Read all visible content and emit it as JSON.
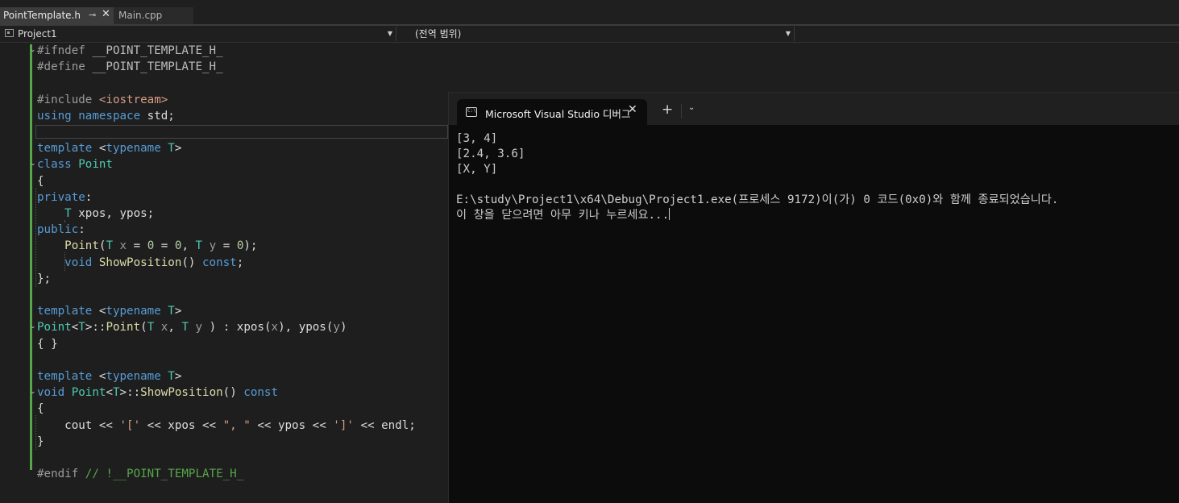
{
  "tabs": [
    {
      "label": "PointTemplate.h",
      "active": true
    },
    {
      "label": "Main.cpp",
      "active": false
    }
  ],
  "nav": {
    "project": "Project1",
    "scope": "(전역 범위)"
  },
  "editor": {
    "lines": [
      {
        "t": [
          [
            "pp",
            "#ifndef "
          ],
          [
            "macro",
            "__POINT_TEMPLATE_H_"
          ]
        ]
      },
      {
        "t": [
          [
            "pp",
            "#define "
          ],
          [
            "macro",
            "__POINT_TEMPLATE_H_"
          ]
        ]
      },
      {
        "t": []
      },
      {
        "t": [
          [
            "pp",
            "#include "
          ],
          [
            "inc",
            "<iostream>"
          ]
        ]
      },
      {
        "t": [
          [
            "kw",
            "using namespace "
          ],
          [
            "",
            "std;"
          ]
        ]
      },
      {
        "t": []
      },
      {
        "t": [
          [
            "kw",
            "template "
          ],
          [
            "",
            "<"
          ],
          [
            "kw",
            "typename "
          ],
          [
            "ty",
            "T"
          ],
          [
            "",
            ">"
          ]
        ]
      },
      {
        "t": [
          [
            "kw",
            "class "
          ],
          [
            "ty",
            "Point"
          ]
        ]
      },
      {
        "t": [
          [
            "",
            "{"
          ]
        ]
      },
      {
        "t": [
          [
            "kw",
            "private"
          ],
          [
            "",
            ":"
          ]
        ]
      },
      {
        "t": [
          [
            "",
            "    "
          ],
          [
            "ty",
            "T "
          ],
          [
            "mem",
            "xpos, ypos;"
          ]
        ]
      },
      {
        "t": [
          [
            "kw",
            "public"
          ],
          [
            "",
            ":"
          ]
        ]
      },
      {
        "t": [
          [
            "",
            "    "
          ],
          [
            "fn",
            "Point"
          ],
          [
            "",
            "("
          ],
          [
            "ty",
            "T "
          ],
          [
            "par",
            "x "
          ],
          [
            "",
            "= "
          ],
          [
            "num",
            "0"
          ],
          [
            "",
            " = "
          ],
          [
            "num",
            "0"
          ],
          [
            "",
            ", "
          ],
          [
            "ty",
            "T "
          ],
          [
            "par",
            "y "
          ],
          [
            "",
            "= "
          ],
          [
            "num",
            "0"
          ],
          [
            "",
            ");"
          ]
        ]
      },
      {
        "t": [
          [
            "",
            "    "
          ],
          [
            "kw",
            "void "
          ],
          [
            "fn",
            "ShowPosition"
          ],
          [
            "",
            "() "
          ],
          [
            "kw",
            "const"
          ],
          [
            "",
            ";"
          ]
        ]
      },
      {
        "t": [
          [
            "",
            "};"
          ]
        ]
      },
      {
        "t": []
      },
      {
        "t": [
          [
            "kw",
            "template "
          ],
          [
            "",
            "<"
          ],
          [
            "kw",
            "typename "
          ],
          [
            "ty",
            "T"
          ],
          [
            "",
            ">"
          ]
        ]
      },
      {
        "t": [
          [
            "ty",
            "Point"
          ],
          [
            "",
            "<"
          ],
          [
            "ty",
            "T"
          ],
          [
            "",
            ">::"
          ],
          [
            "fn",
            "Point"
          ],
          [
            "",
            "("
          ],
          [
            "ty",
            "T "
          ],
          [
            "par",
            "x"
          ],
          [
            "",
            ", "
          ],
          [
            "ty",
            "T "
          ],
          [
            "par",
            "y"
          ],
          [
            "",
            " ) : "
          ],
          [
            "mem",
            "xpos"
          ],
          [
            "",
            "("
          ],
          [
            "par",
            "x"
          ],
          [
            "",
            "), "
          ],
          [
            "mem",
            "ypos"
          ],
          [
            "",
            "("
          ],
          [
            "par",
            "y"
          ],
          [
            "",
            ")"
          ]
        ]
      },
      {
        "t": [
          [
            "",
            "{ }"
          ]
        ]
      },
      {
        "t": []
      },
      {
        "t": [
          [
            "kw",
            "template "
          ],
          [
            "",
            "<"
          ],
          [
            "kw",
            "typename "
          ],
          [
            "ty",
            "T"
          ],
          [
            "",
            ">"
          ]
        ]
      },
      {
        "t": [
          [
            "kw",
            "void "
          ],
          [
            "ty",
            "Point"
          ],
          [
            "",
            "<"
          ],
          [
            "ty",
            "T"
          ],
          [
            "",
            ">::"
          ],
          [
            "fn",
            "ShowPosition"
          ],
          [
            "",
            "() "
          ],
          [
            "kw",
            "const"
          ]
        ]
      },
      {
        "t": [
          [
            "",
            "{"
          ]
        ]
      },
      {
        "t": [
          [
            "",
            "    cout << "
          ],
          [
            "str",
            "'['"
          ],
          [
            "",
            " << xpos << "
          ],
          [
            "str",
            "\", \""
          ],
          [
            "",
            " << ypos << "
          ],
          [
            "str",
            "']'"
          ],
          [
            "",
            " << endl;"
          ]
        ]
      },
      {
        "t": [
          [
            "",
            "}"
          ]
        ]
      },
      {
        "t": []
      },
      {
        "t": [
          [
            "pp",
            "#endif "
          ],
          [
            "cm",
            "// !__POINT_TEMPLATE_H_"
          ]
        ]
      }
    ]
  },
  "console": {
    "title": "Microsoft Visual Studio 디버그",
    "icon_label": "C:\\",
    "lines": [
      "[3, 4]",
      "[2.4, 3.6]",
      "[X, Y]",
      "",
      "E:\\study\\Project1\\x64\\Debug\\Project1.exe(프로세스 9172)이(가) 0 코드(0x0)와 함께 종료되었습니다.",
      "이 창을 닫으려면 아무 키나 누르세요..."
    ]
  }
}
